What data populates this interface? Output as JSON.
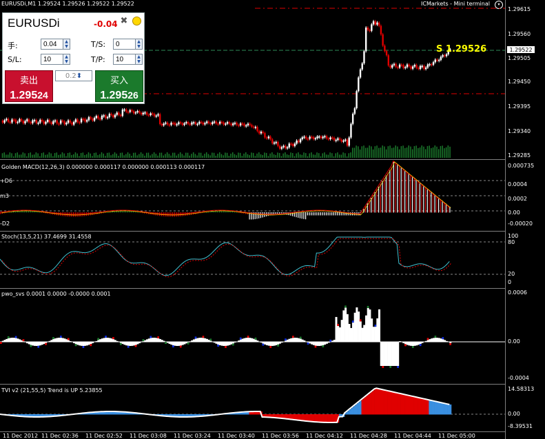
{
  "chart_header": {
    "symbol_info": "EURUSDi,M1  1.29524 1.29526 1.29522 1.29522",
    "terminal_label": "ICMarkets - Mini terminal"
  },
  "price_axis": {
    "labels": [
      "1.29615",
      "1.29560",
      "1.29505",
      "1.29450",
      "1.29395",
      "1.29340",
      "1.29285"
    ],
    "current_price": "1.29522"
  },
  "price_tag": {
    "prefix": "S",
    "value": "1.29526"
  },
  "panel": {
    "symbol": "EURUSDi",
    "change": "-0.04",
    "tools_icon": "crossed-tools-icon",
    "status_icon": "yellow-circle-icon",
    "lot_label": "手:",
    "lot_value": "0.04",
    "sl_label": "S/L:",
    "sl_value": "10",
    "ts_label": "T/S:",
    "ts_value": "0",
    "tp_label": "T/P:",
    "tp_value": "10",
    "sell_label": "卖出",
    "sell_price_main": "1.295",
    "sell_price_big": "24",
    "buy_label": "买入",
    "buy_price_main": "1.295",
    "buy_price_big": "26",
    "lot_step": "0.2"
  },
  "macd": {
    "title": "Golden MACD(12,26,3) 0.000000 0.000117 0.000000 0.000113 0.000117",
    "labels": [
      "0.000735",
      "0.0004",
      "0.0002",
      "0.00",
      "-0.00020"
    ],
    "marks": [
      "+D6",
      "m3",
      "-D2"
    ]
  },
  "stoch": {
    "title": "Stoch(13,5,21) 37.4699 31.4558",
    "labels": [
      "100",
      "80",
      "20",
      "0"
    ]
  },
  "pwo": {
    "title": "pwo_svs 0.0001 0.0000 -0.0000 0.0001",
    "labels": [
      "0.0006",
      "0.00",
      "-0.0004"
    ]
  },
  "tvi": {
    "title": "TVI v2 (21,55,5) Trend is UP 5.23855",
    "labels": [
      "14.58313",
      "0.00",
      "-8.39531"
    ]
  },
  "time_axis": [
    "11 Dec 2012",
    "11 Dec 02:36",
    "11 Dec 02:52",
    "11 Dec 03:08",
    "11 Dec 03:24",
    "11 Dec 03:40",
    "11 Dec 03:56",
    "11 Dec 04:12",
    "11 Dec 04:28",
    "11 Dec 04:44",
    "11 Dec 05:00"
  ],
  "colors": {
    "bull": "#ffffff",
    "bear": "#e00000",
    "sep": "#808080",
    "green": "#1b7a2c",
    "red": "#c8102e"
  }
}
